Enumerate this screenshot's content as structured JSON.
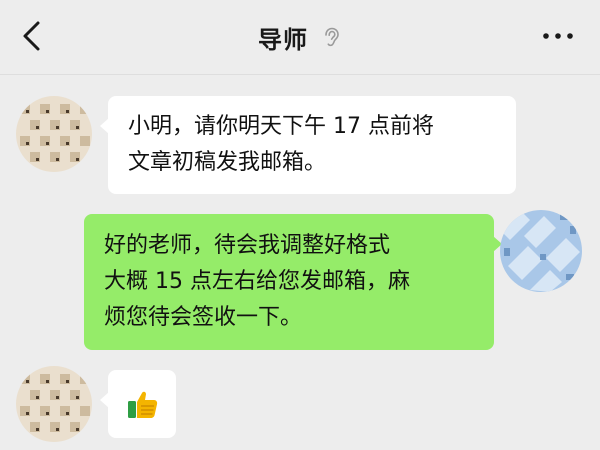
{
  "header": {
    "title": "导师",
    "back_icon": "chevron-left-icon",
    "ear_icon": "ear-icon",
    "more_icon": "more-dots-icon"
  },
  "colors": {
    "background": "#ededed",
    "incoming_bubble": "#ffffff",
    "outgoing_bubble": "#95ec69",
    "text": "#111111"
  },
  "messages": [
    {
      "direction": "incoming",
      "text": "小明，请你明天下午 17 点前将\n文章初稿发我邮箱。"
    },
    {
      "direction": "outgoing",
      "text": "好的老师，待会我调整好格式\n大概 15 点左右给您发邮箱，麻\n烦您待会签收一下。"
    },
    {
      "direction": "incoming",
      "emoji": "thumbs-up-icon"
    }
  ]
}
